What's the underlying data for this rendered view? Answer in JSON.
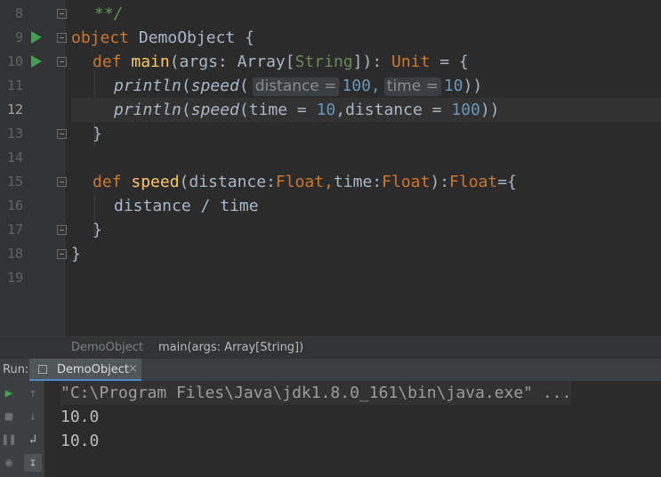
{
  "gutter": {
    "line_numbers": [
      "8",
      "9",
      "10",
      "11",
      "12",
      "13",
      "14",
      "15",
      "16",
      "17",
      "18",
      "19"
    ]
  },
  "code": {
    "l8": "**/",
    "l9": {
      "kw": "object",
      "name": " DemoObject {"
    },
    "l10": {
      "kw": "def",
      "fn": "main",
      "args": "(args: Array[",
      "type_param": "String",
      "close": "]): ",
      "type": "Unit",
      "rest": " = {"
    },
    "l11": {
      "fn": "println",
      "open": "(",
      "fn2": "speed",
      "paren": "(",
      "hint1": "distance =",
      "n1": "100,",
      "hint2": "time =",
      "n2": "10",
      "close": "))"
    },
    "l12": {
      "fn": "println",
      "open": "(",
      "fn2": "speed",
      "rest": "(time = ",
      "n1": "10",
      ",": ",distance = ",
      "n2": "100",
      "close": "))"
    },
    "l13": "}",
    "l15": {
      "kw": "def",
      "fn": "speed",
      "p1": "(distance:",
      "t1": "Float,",
      "p2": "time:",
      "t2": "Float",
      "p3": "):",
      "t3": "Float",
      "p4": "={"
    },
    "l16": "distance / time",
    "l17": "}",
    "l18": "}"
  },
  "breadcrumb": {
    "item1": "DemoObject",
    "item2": "main(args: Array[String])"
  },
  "run_panel": {
    "label": "Run:",
    "tab_title": "DemoObject",
    "tab_close": "×"
  },
  "console": {
    "lines": [
      "\"C:\\Program Files\\Java\\jdk1.8.0_161\\bin\\java.exe\" ...",
      "10.0",
      "10.0"
    ]
  },
  "colors": {
    "keyword": "#CC7832",
    "function": "#FFC66D",
    "number": "#6897BB",
    "run_green": "#499C54"
  }
}
